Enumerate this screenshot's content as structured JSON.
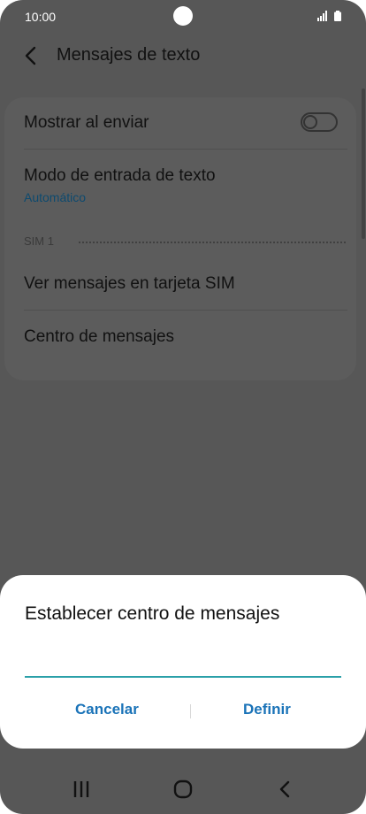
{
  "status_bar": {
    "time": "10:00",
    "signal_icon": "signal-icon",
    "battery_icon": "battery-icon"
  },
  "header": {
    "back_icon": "back-arrow-icon",
    "title": "Mensajes de texto"
  },
  "settings": {
    "show_on_send": {
      "label": "Mostrar al enviar",
      "toggle_on": false
    },
    "input_mode": {
      "label": "Modo de entrada de texto",
      "value": "Automático"
    },
    "sim_section": "SIM 1",
    "view_sim_messages": {
      "label": "Ver mensajes en tarjeta SIM"
    },
    "message_center": {
      "label": "Centro de mensajes"
    }
  },
  "dialog": {
    "title": "Establecer centro de mensajes",
    "input_value": "",
    "cancel_label": "Cancelar",
    "confirm_label": "Definir"
  },
  "nav_bar": {
    "recent_icon": "recent-apps-icon",
    "home_icon": "home-icon",
    "back_icon": "back-icon"
  },
  "colors": {
    "accent": "#1a73b8",
    "input_underline": "#2aa0a8",
    "subtext": "#0d4a6f",
    "overlay_bg": "#575757"
  }
}
